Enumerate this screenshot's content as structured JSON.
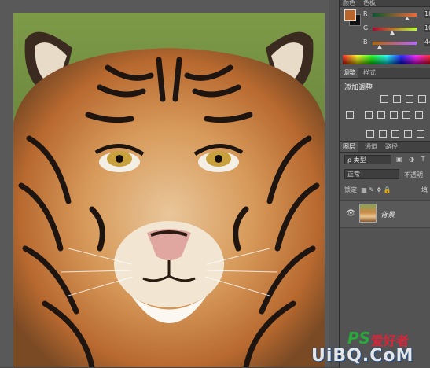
{
  "color_panel": {
    "tabs": [
      "颜色",
      "色板"
    ],
    "foreground_color": "#b7652b",
    "background_color": "#111111",
    "sliders": [
      {
        "label": "R",
        "value": "18"
      },
      {
        "label": "G",
        "value": "10"
      },
      {
        "label": "B",
        "value": "44"
      }
    ]
  },
  "adjustments_panel": {
    "tabs": [
      "调整",
      "样式"
    ],
    "title": "添加调整",
    "icons": [
      "brightness-icon",
      "levels-icon",
      "curves-icon",
      "exposure-icon",
      "vibrance-icon",
      "hue-icon",
      "color-balance-icon",
      "bw-icon",
      "photo-filter-icon",
      "channel-mixer-icon",
      "color-lookup-icon",
      "invert-icon",
      "posterize-icon",
      "threshold-icon",
      "gradient-map-icon",
      "selective-color-icon"
    ]
  },
  "layers_panel": {
    "tabs": [
      "图层",
      "通道",
      "路径"
    ],
    "filter_label": "ρ 类型",
    "filter_icons": "▣ ◑ T",
    "blend_mode": "正常",
    "opacity_label": "不透明",
    "lock_label": "锁定:",
    "lock_icons": "▦ ✎ ✥ 🔒",
    "fill_label": "填",
    "layer": {
      "name": "背景",
      "visible": true
    }
  },
  "watermark": {
    "brand": "PS",
    "brand_cn": "爱好者",
    "url": "UiBQ.CoM"
  },
  "colors": {
    "ui_dark": "#464646",
    "panel": "#535353",
    "accent_green": "#29a83b",
    "accent_red": "#d8243a"
  }
}
